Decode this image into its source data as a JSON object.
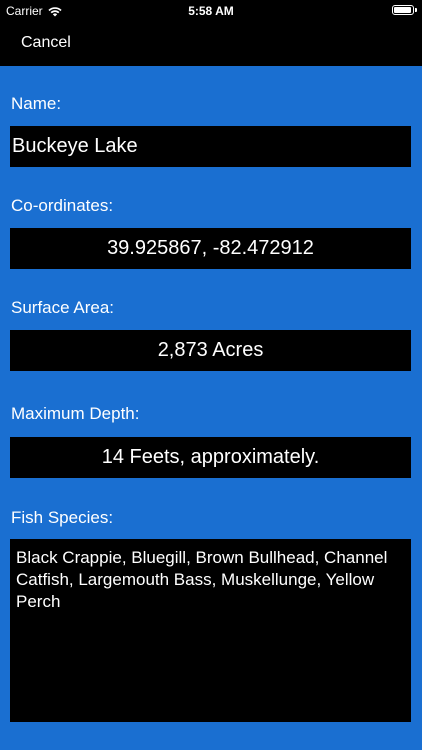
{
  "status_bar": {
    "carrier": "Carrier",
    "time": "5:58 AM"
  },
  "nav": {
    "cancel_label": "Cancel"
  },
  "form": {
    "name_label": "Name:",
    "name_value": "Buckeye Lake",
    "coordinates_label": "Co-ordinates:",
    "coordinates_value": "39.925867, -82.472912",
    "surface_area_label": "Surface Area:",
    "surface_area_value": "2,873 Acres",
    "max_depth_label": "Maximum Depth:",
    "max_depth_value": "14 Feets, approximately.",
    "fish_species_label": "Fish Species:",
    "fish_species_value": "Black Crappie, Bluegill, Brown Bullhead, Channel Catfish, Largemouth Bass, Muskellunge, Yellow Perch"
  },
  "colors": {
    "background": "#1a6fd1",
    "field_background": "#000000",
    "text": "#ffffff"
  }
}
